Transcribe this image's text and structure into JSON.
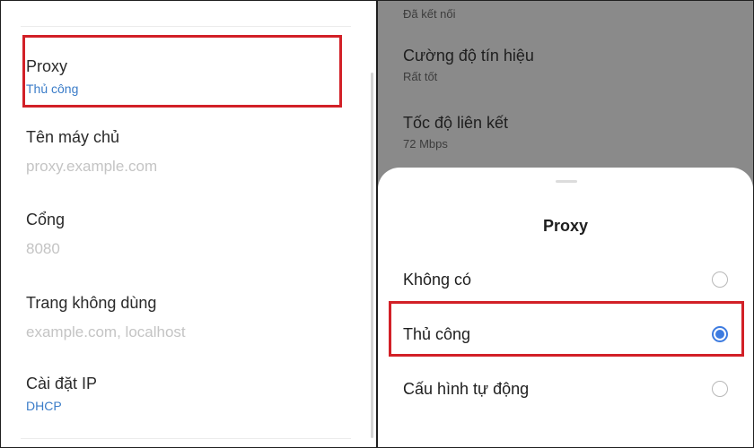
{
  "colors": {
    "accent_blue": "#3a7cc8",
    "radio_selected": "#3d7be0",
    "highlight_red": "#d22027",
    "dim_overlay": "#8a8a8a"
  },
  "left": {
    "rows": [
      {
        "label": "Proxy",
        "value": "Thủ công"
      },
      {
        "label": "Tên máy chủ",
        "placeholder": "proxy.example.com"
      },
      {
        "label": "Cổng",
        "placeholder": "8080"
      },
      {
        "label": "Trang không dùng",
        "placeholder": "example.com, localhost"
      },
      {
        "label": "Cài đặt IP",
        "value": "DHCP"
      }
    ]
  },
  "right": {
    "background_items": [
      {
        "subtitle": "Đã kết nối"
      },
      {
        "title": "Cường độ tín hiệu",
        "subtitle": "Rất tốt"
      },
      {
        "title": "Tốc độ liên kết",
        "subtitle": "72 Mbps"
      }
    ],
    "sheet": {
      "title": "Proxy",
      "selected_index": 1,
      "options": [
        {
          "label": "Không có"
        },
        {
          "label": "Thủ công"
        },
        {
          "label": "Cấu hình tự động"
        }
      ]
    }
  }
}
